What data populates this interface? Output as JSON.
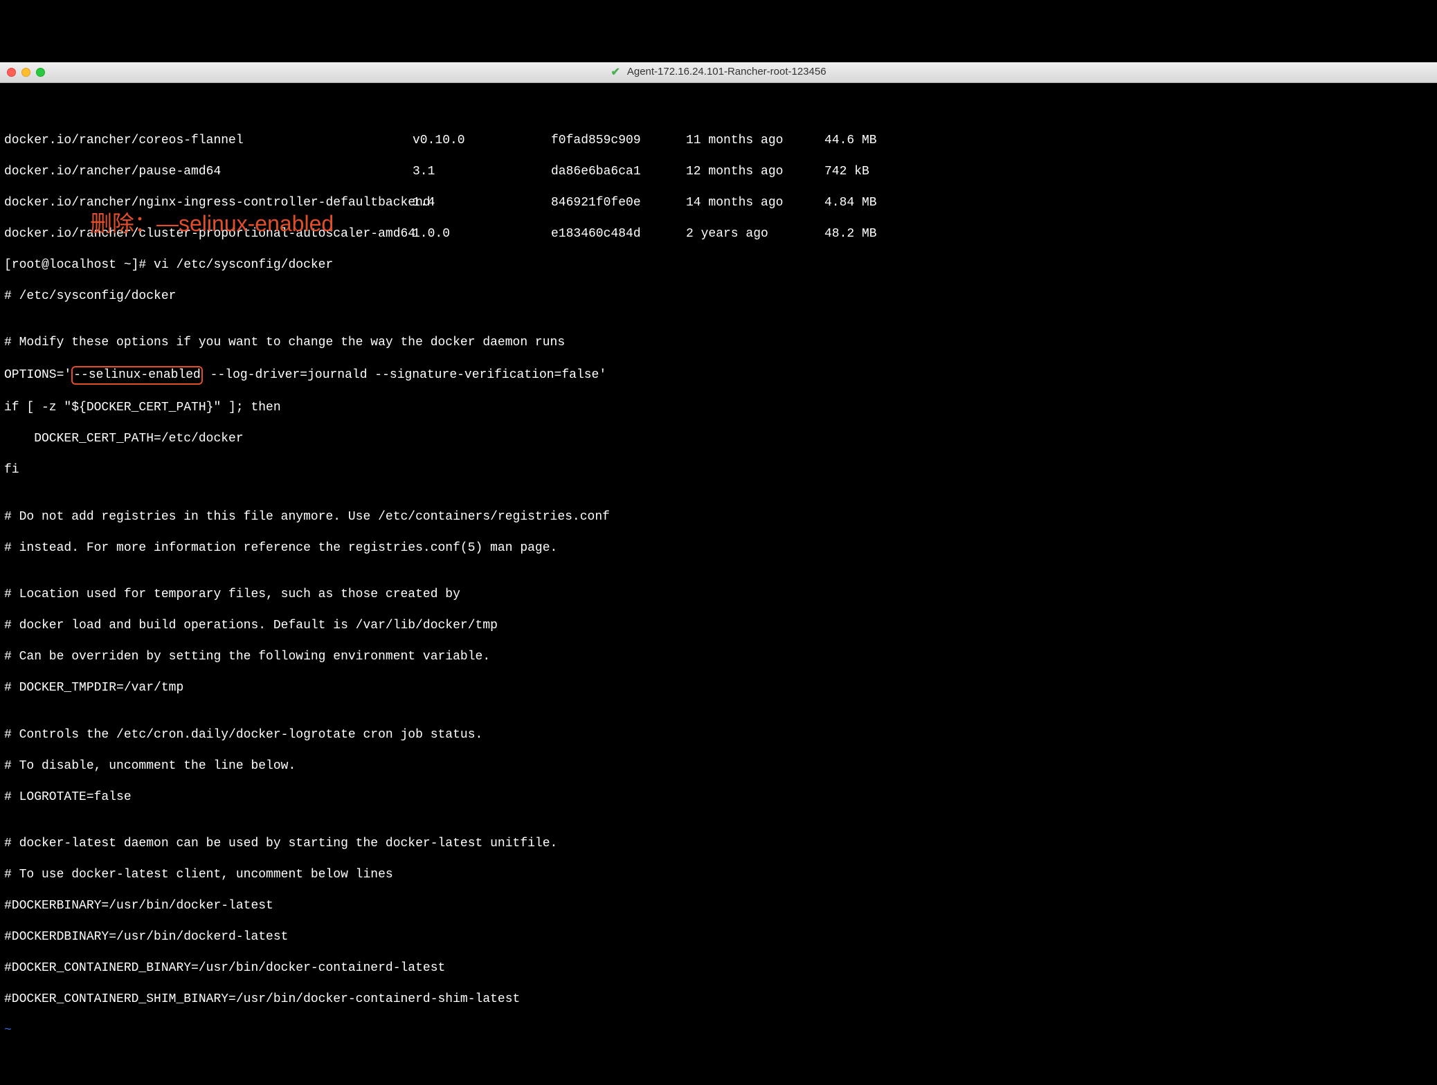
{
  "window": {
    "title": "Agent-172.16.24.101-Rancher-root-123456"
  },
  "images": [
    {
      "repo": "docker.io/rancher/coreos-flannel",
      "tag": "v0.10.0",
      "id": "f0fad859c909",
      "age": "11 months ago",
      "size": "44.6 MB"
    },
    {
      "repo": "docker.io/rancher/pause-amd64",
      "tag": "3.1",
      "id": "da86e6ba6ca1",
      "age": "12 months ago",
      "size": "742 kB"
    },
    {
      "repo": "docker.io/rancher/nginx-ingress-controller-defaultbackend",
      "tag": "1.4",
      "id": "846921f0fe0e",
      "age": "14 months ago",
      "size": "4.84 MB"
    },
    {
      "repo": "docker.io/rancher/cluster-proportional-autoscaler-amd64",
      "tag": "1.0.0",
      "id": "e183460c484d",
      "age": "2 years ago",
      "size": "48.2 MB"
    }
  ],
  "prompt": "[root@localhost ~]# vi /etc/sysconfig/docker",
  "annotation": "删除：—selinux-enabled",
  "file": {
    "l1": "# /etc/sysconfig/docker",
    "l2": "",
    "l3": "# Modify these options if you want to change the way the docker daemon runs",
    "opt_pre": "OPTIONS='",
    "opt_hl": "--selinux-enabled",
    "opt_post": " --log-driver=journald --signature-verification=false'",
    "l5": "if [ -z \"${DOCKER_CERT_PATH}\" ]; then",
    "l6": "    DOCKER_CERT_PATH=/etc/docker",
    "l7": "fi",
    "l8": "",
    "l9": "# Do not add registries in this file anymore. Use /etc/containers/registries.conf",
    "l10": "# instead. For more information reference the registries.conf(5) man page.",
    "l11": "",
    "l12": "# Location used for temporary files, such as those created by",
    "l13": "# docker load and build operations. Default is /var/lib/docker/tmp",
    "l14": "# Can be overriden by setting the following environment variable.",
    "l15": "# DOCKER_TMPDIR=/var/tmp",
    "l16": "",
    "l17": "# Controls the /etc/cron.daily/docker-logrotate cron job status.",
    "l18": "# To disable, uncomment the line below.",
    "l19": "# LOGROTATE=false",
    "l20": "",
    "l21": "# docker-latest daemon can be used by starting the docker-latest unitfile.",
    "l22": "# To use docker-latest client, uncomment below lines",
    "l23": "#DOCKERBINARY=/usr/bin/docker-latest",
    "l24": "#DOCKERDBINARY=/usr/bin/dockerd-latest",
    "l25": "#DOCKER_CONTAINERD_BINARY=/usr/bin/docker-containerd-latest",
    "l26": "#DOCKER_CONTAINERD_SHIM_BINARY=/usr/bin/docker-containerd-shim-latest"
  },
  "tilde": "~"
}
